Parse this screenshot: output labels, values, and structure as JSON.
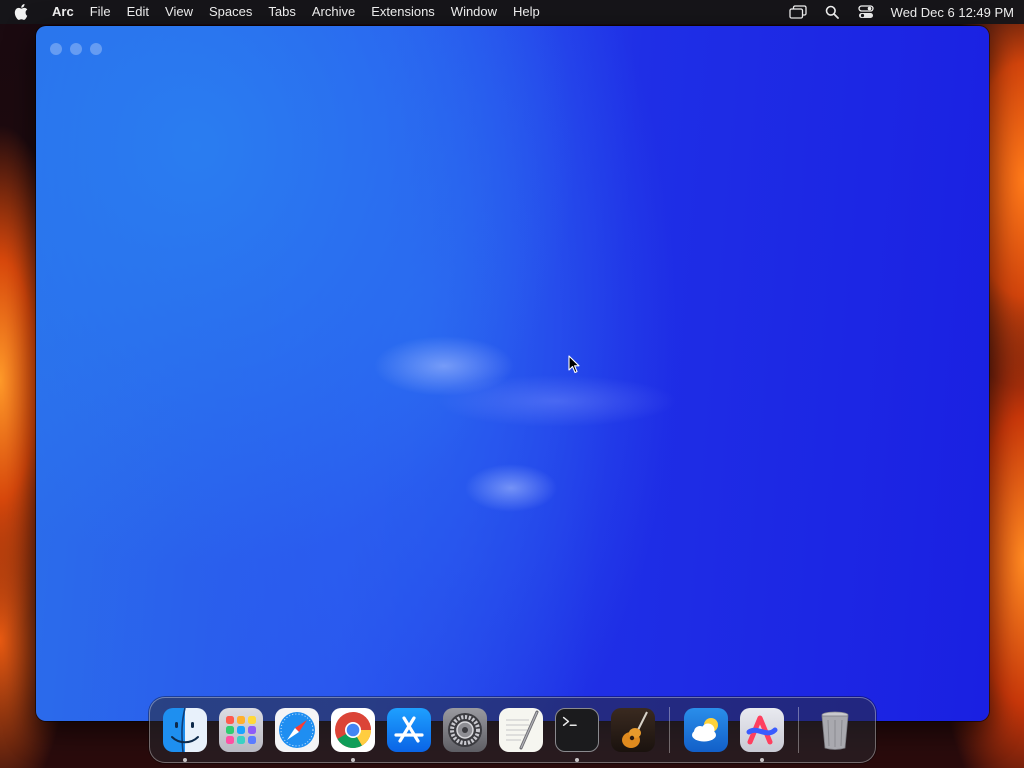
{
  "menubar": {
    "app_name": "Arc",
    "items": [
      "File",
      "Edit",
      "View",
      "Spaces",
      "Tabs",
      "Archive",
      "Extensions",
      "Window",
      "Help"
    ],
    "status_icons": [
      "screen-mirroring-icon",
      "spotlight-search-icon",
      "control-center-icon"
    ],
    "clock": "Wed Dec 6  12:49 PM"
  },
  "window": {
    "app": "Arc",
    "state": "loading",
    "accent_colors": [
      "#2b6fea",
      "#1a20e2"
    ]
  },
  "dock": {
    "apps": [
      {
        "name": "Finder",
        "icon": "finder-icon",
        "running": true
      },
      {
        "name": "Launchpad",
        "icon": "launchpad-icon",
        "running": false
      },
      {
        "name": "Safari",
        "icon": "safari-icon",
        "running": false
      },
      {
        "name": "Google Chrome",
        "icon": "chrome-icon",
        "running": true
      },
      {
        "name": "App Store",
        "icon": "app-store-icon",
        "running": false
      },
      {
        "name": "System Settings",
        "icon": "system-settings-icon",
        "running": false
      },
      {
        "name": "TextEdit",
        "icon": "textedit-icon",
        "running": false
      },
      {
        "name": "Terminal",
        "icon": "terminal-icon",
        "running": true
      },
      {
        "name": "GarageBand",
        "icon": "garageband-icon",
        "running": false
      }
    ],
    "recent_apps": [
      {
        "name": "Weather",
        "icon": "weather-icon",
        "running": false
      },
      {
        "name": "Arc",
        "icon": "arc-icon",
        "running": true
      }
    ],
    "trash": {
      "name": "Trash",
      "icon": "trash-icon"
    }
  }
}
